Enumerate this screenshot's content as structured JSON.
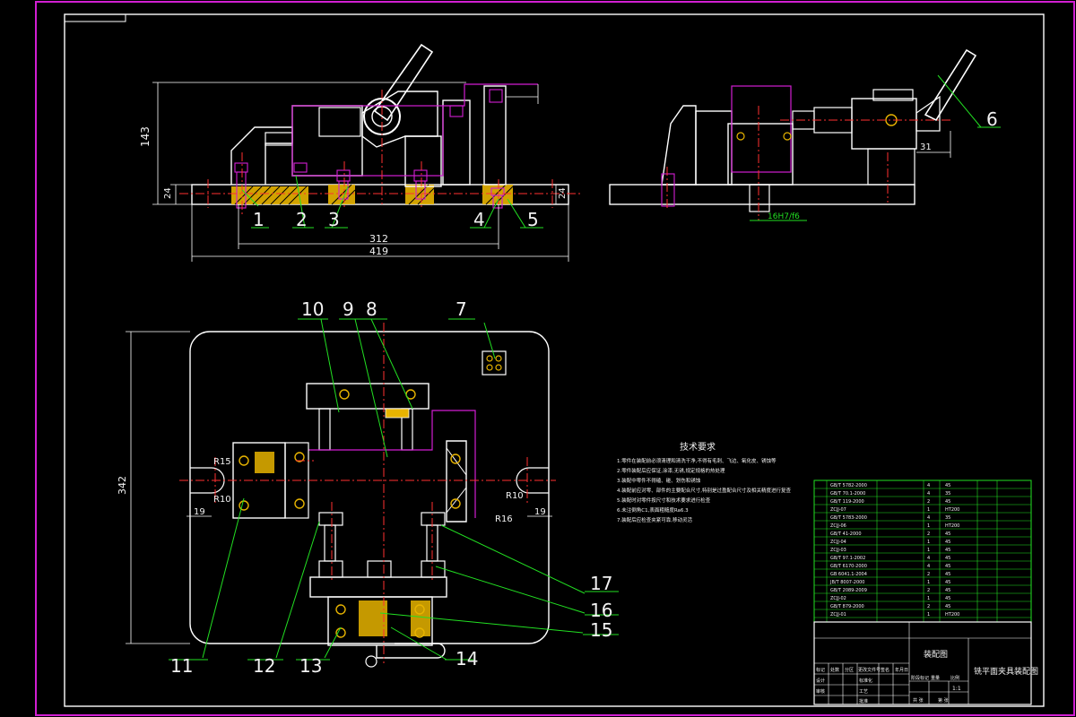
{
  "drawing": {
    "title": "铣平面夹具装配图",
    "subtitle": "装配图",
    "tech_requirements_title": "技术要求",
    "tech_requirements": [
      "1.零件在装配前必须清理和清洗干净,不得有毛刺、飞边、氧化皮、锈蚀等",
      "2.零件装配后应保证,涂漆,无锈,规定规格的热处理",
      "3.装配中零件不得磕、碰、划伤和锈蚀",
      "4.装配前应对零、部件的主要配合尺寸,特别是过盈配合尺寸及相关精度进行复查",
      "5.装配时对零件按尺寸和技术要求进行检查",
      "6.未注倒角C1,表面粗糙度Ra6.3",
      "7.装配后应检查夹紧可靠,移动灵活"
    ]
  },
  "dimensions": {
    "height_143": "143",
    "base_24_left": "24",
    "base_24_right": "24",
    "len_312": "312",
    "len_419": "419",
    "height_342": "342",
    "side_31": "31",
    "fit_16": "16H7/f6",
    "r15": "R15",
    "r10_left": "R10",
    "r10_right": "R10",
    "r15_right": "R16",
    "d19_left": "19",
    "d19_right": "19"
  },
  "balloons": [
    "1",
    "2",
    "3",
    "4",
    "5",
    "6",
    "7",
    "8",
    "9",
    "10",
    "11",
    "12",
    "13",
    "14",
    "15",
    "16",
    "17"
  ],
  "bom_codes": [
    "GB/T 5782-2000",
    "GB/T 70.1-2000",
    "GB/T 119-2000",
    "ZCJJ-07",
    "GB/T 5783-2000",
    "ZCJJ-06",
    "GB/T 41-2000",
    "ZCJJ-04",
    "ZCJJ-03",
    "GB/T 97.1-2002",
    "GB/T 6170-2000",
    "GB 6041.1-2004",
    "JB/T 8007-2000",
    "GB/T 2089-2009",
    "ZCJJ-02",
    "GB/T 879-2000",
    "ZCJJ-01"
  ],
  "bom_qty": [
    "4",
    "4",
    "2",
    "1",
    "4",
    "1",
    "2",
    "1",
    "1",
    "4",
    "4",
    "2",
    "1",
    "2",
    "1",
    "2",
    "1"
  ],
  "bom_material": [
    "45",
    "35",
    "45",
    "HT200",
    "35",
    "HT200",
    "45",
    "45",
    "45",
    "45",
    "45",
    "45",
    "45",
    "45",
    "45",
    "45",
    "HT200"
  ],
  "title_block": {
    "scale": "1:1",
    "cells": [
      "标记",
      "处数",
      "分区",
      "更改文件号",
      "签名",
      "年月日",
      "设计",
      "标准化",
      "审核",
      "工艺",
      "批准",
      "阶段标记",
      "重量",
      "比例",
      "共 张",
      "第 张"
    ]
  },
  "colors": {
    "background": "#000000",
    "outline": "#ffffff",
    "dimension": "#22e022",
    "center": "#ff3030",
    "phantom": "#d21ed2",
    "section": "#e8b400",
    "part": "#f2f2f2"
  }
}
